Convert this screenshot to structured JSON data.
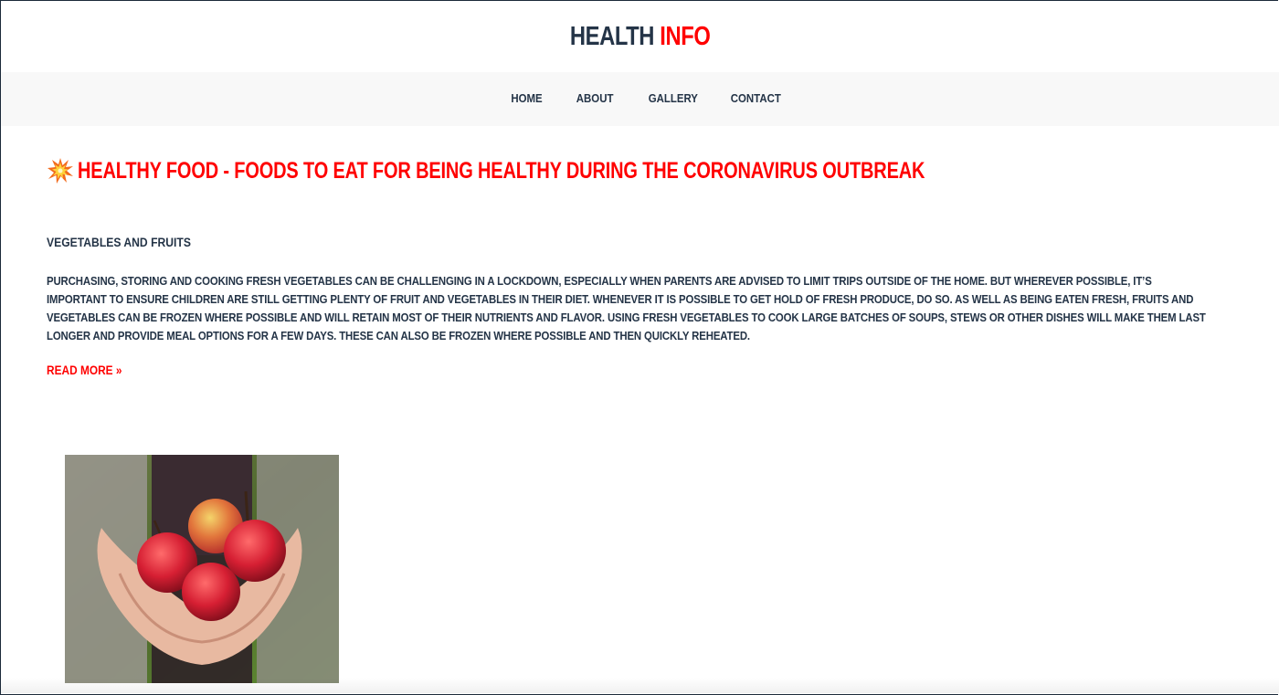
{
  "header": {
    "logo_part1": "HEALTH",
    "logo_part2": "INFO"
  },
  "nav": {
    "items": [
      {
        "label": "HOME"
      },
      {
        "label": "ABOUT"
      },
      {
        "label": "GALLERY"
      },
      {
        "label": "CONTACT"
      }
    ]
  },
  "article": {
    "headline_icon": "collision-burst-icon",
    "headline": "HEALTHY FOOD - FOODS TO EAT FOR BEING HEALTHY DURING THE CORONAVIRUS OUTBREAK",
    "section_title": "VEGETABLES AND FRUITS",
    "body": "PURCHASING, STORING AND COOKING FRESH VEGETABLES CAN BE CHALLENGING IN A LOCKDOWN, ESPECIALLY WHEN PARENTS ARE ADVISED TO LIMIT TRIPS OUTSIDE OF THE HOME. BUT WHEREVER POSSIBLE, IT’S IMPORTANT TO ENSURE CHILDREN ARE STILL GETTING PLENTY OF FRUIT AND VEGETABLES IN THEIR DIET. WHENEVER IT IS POSSIBLE TO GET HOLD OF FRESH PRODUCE, DO SO. AS WELL AS BEING EATEN FRESH, FRUITS AND VEGETABLES CAN BE FROZEN WHERE POSSIBLE AND WILL RETAIN MOST OF THEIR NUTRIENTS AND FLAVOR. USING FRESH VEGETABLES TO COOK LARGE BATCHES OF SOUPS, STEWS OR OTHER DISHES WILL MAKE THEM LAST LONGER AND PROVIDE MEAL OPTIONS FOR A FEW DAYS. THESE CAN ALSO BE FROZEN WHERE POSSIBLE AND THEN QUICKLY REHEATED.",
    "read_more": "READ MORE »",
    "image_subject": "hands holding red apples"
  },
  "colors": {
    "accent": "#ff0000",
    "text_dark": "#243447",
    "nav_background": "#f8f8f8"
  }
}
